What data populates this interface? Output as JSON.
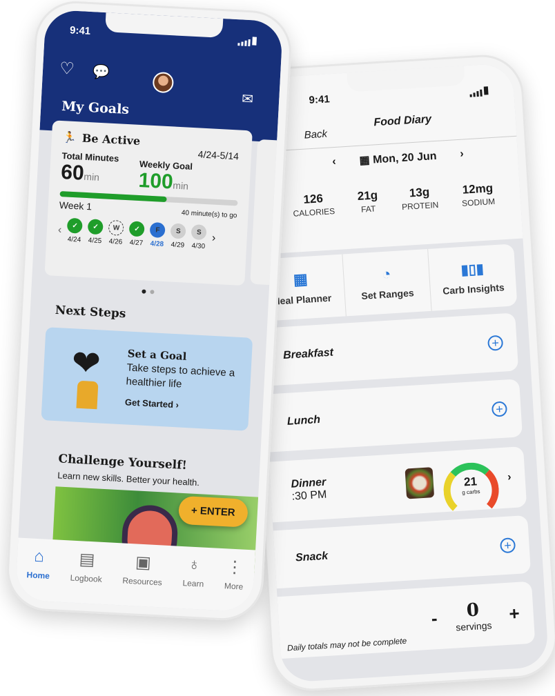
{
  "colors": {
    "brand_navy": "#17307a",
    "accent_blue": "#2b78d6",
    "green": "#1f9d2a",
    "enter_yellow": "#f0b02c"
  },
  "food_diary": {
    "time": "9:41",
    "back": "Back",
    "title": "Food Diary",
    "date": "Mon, 20 Jun",
    "macros": [
      {
        "value": "126",
        "label": "CALORIES"
      },
      {
        "value": "21g",
        "label": "FAT"
      },
      {
        "value": "13g",
        "label": "PROTEIN"
      },
      {
        "value": "12mg",
        "label": "SODIUM"
      }
    ],
    "tools": [
      {
        "label": "Meal Planner",
        "icon": "calendar-grid-icon"
      },
      {
        "label": "Set Ranges",
        "icon": "gauge-icon"
      },
      {
        "label": "Carb Insights",
        "icon": "bar-chart-icon"
      }
    ],
    "meals": {
      "breakfast": "Breakfast",
      "lunch": "Lunch",
      "dinner": "Dinner",
      "dinner_time": ":30 PM",
      "snack": "Snack"
    },
    "carbs": {
      "value": "21",
      "label": "g carbs"
    },
    "servings": {
      "minus": "-",
      "value": "0",
      "plus": "+",
      "label": "servings"
    },
    "note": "Daily totals may not be complete"
  },
  "home": {
    "time": "9:41",
    "title": "My Goals",
    "goal": {
      "name": "Be Active",
      "range": "4/24-5/14",
      "total_label": "Total Minutes",
      "total": "60",
      "weekly_label": "Weekly Goal",
      "weekly": "100",
      "unit": "min",
      "progress": 0.6,
      "week": "Week 1",
      "remaining": "40 minute(s) to go",
      "days": [
        {
          "mark": "✓",
          "date": "4/24",
          "state": "done"
        },
        {
          "mark": "✓",
          "date": "4/25",
          "state": "done"
        },
        {
          "mark": "W",
          "date": "4/26",
          "state": "missed"
        },
        {
          "mark": "✓",
          "date": "4/27",
          "state": "done"
        },
        {
          "mark": "F",
          "date": "4/28",
          "state": "today"
        },
        {
          "mark": "S",
          "date": "4/29",
          "state": "future"
        },
        {
          "mark": "S",
          "date": "4/30",
          "state": "future"
        }
      ]
    },
    "next_steps": "Next Steps",
    "promo": {
      "title": "Set a Goal",
      "body": "Take steps to achieve a healthier life",
      "cta": "Get Started"
    },
    "challenge": {
      "title": "Challenge Yourself!",
      "subtitle": "Learn new skills. Better your health.",
      "enter": "ENTER"
    },
    "nav": [
      {
        "label": "Home",
        "icon": "home-icon"
      },
      {
        "label": "Logbook",
        "icon": "book-icon"
      },
      {
        "label": "Resources",
        "icon": "box-icon"
      },
      {
        "label": "Learn",
        "icon": "lightbulb-icon"
      },
      {
        "label": "More",
        "icon": "more-icon"
      }
    ]
  }
}
